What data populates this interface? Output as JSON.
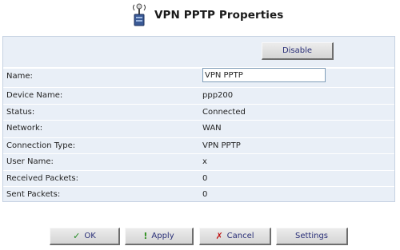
{
  "header": {
    "title": "VPN PPTP Properties",
    "icon": "network-antenna-icon"
  },
  "toolbar": {
    "disable_label": "Disable"
  },
  "fields": {
    "name": {
      "label": "Name:",
      "value": "VPN PPTP"
    },
    "rows": [
      {
        "label": "Device Name:",
        "value": "ppp200"
      },
      {
        "label": "Status:",
        "value": "Connected"
      },
      {
        "label": "Network:",
        "value": "WAN"
      },
      {
        "label": "Connection Type:",
        "value": "VPN PPTP"
      },
      {
        "label": "User Name:",
        "value": "x"
      },
      {
        "label": "Received Packets:",
        "value": "0"
      },
      {
        "label": "Sent Packets:",
        "value": "0"
      }
    ]
  },
  "footer": {
    "ok_label": "OK",
    "apply_label": "Apply",
    "cancel_label": "Cancel",
    "settings_label": "Settings",
    "ok_icon": "✓",
    "apply_icon": "!",
    "cancel_icon": "✗"
  },
  "colors": {
    "panel_bg": "#e9eff7",
    "button_text": "#2a2f78",
    "ok": "#1f8a1f",
    "cancel": "#c01818"
  }
}
